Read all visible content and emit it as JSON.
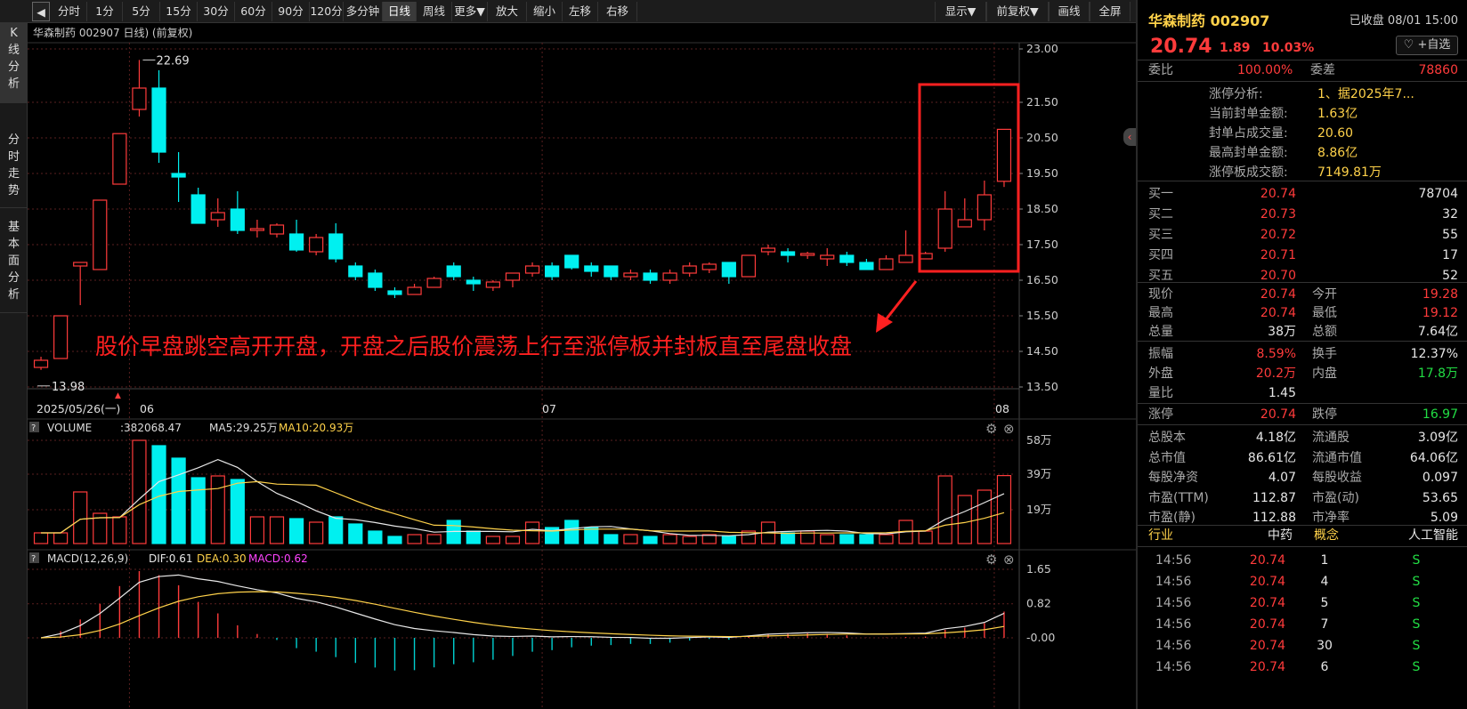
{
  "toolbar": {
    "items": [
      {
        "label": "分时",
        "active": false
      },
      {
        "label": "1分",
        "active": false
      },
      {
        "label": "5分",
        "active": false
      },
      {
        "label": "15分",
        "active": false
      },
      {
        "label": "30分",
        "active": false
      },
      {
        "label": "60分",
        "active": false
      },
      {
        "label": "90分",
        "active": false
      },
      {
        "label": "120分",
        "active": false
      },
      {
        "label": "多分钟",
        "active": false
      },
      {
        "label": "日线",
        "active": true
      },
      {
        "label": "周线",
        "active": false
      },
      {
        "label": "更多▼",
        "active": false
      },
      {
        "label": "放大",
        "active": false
      },
      {
        "label": "缩小",
        "active": false
      },
      {
        "label": "左移",
        "active": false
      },
      {
        "label": "右移",
        "active": false
      }
    ],
    "right_items": [
      "显示▼",
      "前复权▼",
      "画线",
      "全屏"
    ]
  },
  "side_tabs": [
    {
      "label": "K线分析",
      "active": true
    },
    {
      "label": "分时走势",
      "active": false
    },
    {
      "label": "基本面分析",
      "active": false
    }
  ],
  "kchart": {
    "header": "华森制药 002907 日线) (前复权)",
    "high_label": "22.69",
    "low_label": "13.98",
    "y_ticks": [
      "23.00",
      "21.50",
      "20.50",
      "19.50",
      "18.50",
      "17.50",
      "16.50",
      "15.50",
      "14.50",
      "13.50"
    ],
    "x_labels": [
      "2025/05/26(一)",
      "06",
      "07",
      "08"
    ],
    "annotation": "股价早盘跳空高开开盘，开盘之后股价震荡上行至涨停板并封板直至尾盘收盘",
    "colors": {
      "up": "#ff3b3b",
      "down": "#00f0f0",
      "grid": "#5a1f1f"
    }
  },
  "volume": {
    "label": "VOLUME",
    "value": ":382068.47",
    "ma5": "MA5:29.25万",
    "ma10": "MA10:20.93万",
    "y_ticks": [
      "58万",
      "39万",
      "19万"
    ]
  },
  "macd": {
    "label": "MACD(12,26,9)",
    "dif": "DIF:0.61",
    "dea": "DEA:0.30",
    "macd": "MACD:0.62",
    "y_ticks": [
      "1.65",
      "0.82",
      "-0.00"
    ]
  },
  "chart_data": {
    "type": "candlestick",
    "title": "华森制药 002907 日线",
    "candles": [
      {
        "o": 14.05,
        "h": 14.35,
        "l": 13.98,
        "c": 14.25,
        "v": 6
      },
      {
        "o": 14.3,
        "h": 15.5,
        "l": 14.3,
        "c": 15.5,
        "v": 6
      },
      {
        "o": 16.9,
        "h": 17.0,
        "l": 15.8,
        "c": 17.0,
        "v": 29
      },
      {
        "o": 16.8,
        "h": 18.75,
        "l": 16.8,
        "c": 18.75,
        "v": 17
      },
      {
        "o": 19.2,
        "h": 20.62,
        "l": 19.2,
        "c": 20.62,
        "v": 15
      },
      {
        "o": 21.3,
        "h": 22.69,
        "l": 21.1,
        "c": 21.9,
        "v": 58
      },
      {
        "o": 21.9,
        "h": 22.4,
        "l": 19.8,
        "c": 20.1,
        "v": 55
      },
      {
        "o": 19.5,
        "h": 20.1,
        "l": 18.7,
        "c": 19.4,
        "v": 48
      },
      {
        "o": 18.9,
        "h": 19.1,
        "l": 18.1,
        "c": 18.1,
        "v": 37
      },
      {
        "o": 18.2,
        "h": 18.8,
        "l": 18.0,
        "c": 18.4,
        "v": 38
      },
      {
        "o": 18.5,
        "h": 19.0,
        "l": 17.8,
        "c": 17.9,
        "v": 36
      },
      {
        "o": 17.9,
        "h": 18.2,
        "l": 17.7,
        "c": 17.95,
        "v": 15
      },
      {
        "o": 17.8,
        "h": 18.1,
        "l": 17.7,
        "c": 18.05,
        "v": 15
      },
      {
        "o": 17.8,
        "h": 18.2,
        "l": 17.3,
        "c": 17.35,
        "v": 14
      },
      {
        "o": 17.3,
        "h": 17.8,
        "l": 17.2,
        "c": 17.7,
        "v": 12
      },
      {
        "o": 17.8,
        "h": 18.1,
        "l": 17.0,
        "c": 17.1,
        "v": 15
      },
      {
        "o": 16.9,
        "h": 17.0,
        "l": 16.5,
        "c": 16.6,
        "v": 11
      },
      {
        "o": 16.7,
        "h": 16.8,
        "l": 16.2,
        "c": 16.3,
        "v": 7
      },
      {
        "o": 16.2,
        "h": 16.3,
        "l": 16.0,
        "c": 16.1,
        "v": 4
      },
      {
        "o": 16.1,
        "h": 16.4,
        "l": 16.1,
        "c": 16.3,
        "v": 5
      },
      {
        "o": 16.3,
        "h": 16.6,
        "l": 16.3,
        "c": 16.55,
        "v": 5
      },
      {
        "o": 16.9,
        "h": 17.0,
        "l": 16.5,
        "c": 16.6,
        "v": 13
      },
      {
        "o": 16.5,
        "h": 16.6,
        "l": 16.2,
        "c": 16.4,
        "v": 7
      },
      {
        "o": 16.3,
        "h": 16.5,
        "l": 16.2,
        "c": 16.45,
        "v": 4
      },
      {
        "o": 16.5,
        "h": 16.7,
        "l": 16.3,
        "c": 16.7,
        "v": 4
      },
      {
        "o": 16.7,
        "h": 17.0,
        "l": 16.6,
        "c": 16.9,
        "v": 12
      },
      {
        "o": 16.9,
        "h": 17.0,
        "l": 16.5,
        "c": 16.6,
        "v": 9
      },
      {
        "o": 17.2,
        "h": 17.2,
        "l": 16.8,
        "c": 16.85,
        "v": 13
      },
      {
        "o": 16.9,
        "h": 17.0,
        "l": 16.6,
        "c": 16.75,
        "v": 9
      },
      {
        "o": 16.9,
        "h": 16.9,
        "l": 16.5,
        "c": 16.6,
        "v": 5
      },
      {
        "o": 16.6,
        "h": 16.8,
        "l": 16.5,
        "c": 16.7,
        "v": 5
      },
      {
        "o": 16.7,
        "h": 16.8,
        "l": 16.4,
        "c": 16.5,
        "v": 4
      },
      {
        "o": 16.5,
        "h": 16.8,
        "l": 16.4,
        "c": 16.7,
        "v": 5
      },
      {
        "o": 16.7,
        "h": 17.0,
        "l": 16.6,
        "c": 16.9,
        "v": 4
      },
      {
        "o": 16.8,
        "h": 17.0,
        "l": 16.7,
        "c": 16.95,
        "v": 5
      },
      {
        "o": 17.0,
        "h": 17.0,
        "l": 16.4,
        "c": 16.6,
        "v": 4
      },
      {
        "o": 16.6,
        "h": 17.2,
        "l": 16.6,
        "c": 17.2,
        "v": 7
      },
      {
        "o": 17.3,
        "h": 17.5,
        "l": 17.2,
        "c": 17.4,
        "v": 12
      },
      {
        "o": 17.3,
        "h": 17.4,
        "l": 17.0,
        "c": 17.2,
        "v": 6
      },
      {
        "o": 17.2,
        "h": 17.3,
        "l": 17.1,
        "c": 17.25,
        "v": 7
      },
      {
        "o": 17.1,
        "h": 17.4,
        "l": 16.9,
        "c": 17.2,
        "v": 5
      },
      {
        "o": 17.2,
        "h": 17.3,
        "l": 16.9,
        "c": 17.0,
        "v": 5
      },
      {
        "o": 17.0,
        "h": 17.1,
        "l": 16.8,
        "c": 16.8,
        "v": 5
      },
      {
        "o": 16.8,
        "h": 17.2,
        "l": 16.8,
        "c": 17.1,
        "v": 5
      },
      {
        "o": 17.0,
        "h": 17.9,
        "l": 17.0,
        "c": 17.2,
        "v": 13
      },
      {
        "o": 17.1,
        "h": 17.3,
        "l": 17.1,
        "c": 17.25,
        "v": 7
      },
      {
        "o": 17.4,
        "h": 19.0,
        "l": 17.3,
        "c": 18.5,
        "v": 38
      },
      {
        "o": 18.0,
        "h": 18.8,
        "l": 18.0,
        "c": 18.2,
        "v": 27
      },
      {
        "o": 18.2,
        "h": 19.3,
        "l": 17.9,
        "c": 18.9,
        "v": 30
      },
      {
        "o": 19.28,
        "h": 20.74,
        "l": 19.12,
        "c": 20.74,
        "v": 38.2
      }
    ]
  },
  "quote": {
    "name": "华森制药 002907",
    "status": "已收盘 08/01 15:00",
    "price": "20.74",
    "change": "1.89",
    "change_pct": "10.03%",
    "add_fav": "+自选",
    "webi_label": "委比",
    "webi": "100.00%",
    "weicha_label": "委差",
    "weicha": "78860",
    "limit_analysis": [
      {
        "k": "涨停分析:",
        "v": "1、据2025年7..."
      },
      {
        "k": "当前封单金额:",
        "v": "1.63亿"
      },
      {
        "k": "封单占成交量:",
        "v": "20.60"
      },
      {
        "k": "最高封单金额:",
        "v": "8.86亿"
      },
      {
        "k": "涨停板成交额:",
        "v": "7149.81万"
      }
    ],
    "bids": [
      {
        "k": "买一",
        "p": "20.74",
        "q": "78704"
      },
      {
        "k": "买二",
        "p": "20.73",
        "q": "32"
      },
      {
        "k": "买三",
        "p": "20.72",
        "q": "55"
      },
      {
        "k": "买四",
        "p": "20.71",
        "q": "17"
      },
      {
        "k": "买五",
        "p": "20.70",
        "q": "52"
      }
    ],
    "stats": [
      [
        {
          "k": "现价",
          "v": "20.74",
          "c": "red"
        },
        {
          "k": "今开",
          "v": "19.28",
          "c": "red"
        }
      ],
      [
        {
          "k": "最高",
          "v": "20.74",
          "c": "red"
        },
        {
          "k": "最低",
          "v": "19.12",
          "c": "red"
        }
      ],
      [
        {
          "k": "总量",
          "v": "38万",
          "c": "white"
        },
        {
          "k": "总额",
          "v": "7.64亿",
          "c": "white"
        }
      ]
    ],
    "stats2": [
      [
        {
          "k": "振幅",
          "v": "8.59%",
          "c": "red"
        },
        {
          "k": "换手",
          "v": "12.37%",
          "c": "white"
        }
      ],
      [
        {
          "k": "外盘",
          "v": "20.2万",
          "c": "red"
        },
        {
          "k": "内盘",
          "v": "17.8万",
          "c": "green"
        }
      ],
      [
        {
          "k": "量比",
          "v": "1.45",
          "c": "white"
        }
      ]
    ],
    "limits": [
      {
        "k": "涨停",
        "v": "20.74",
        "c": "red"
      },
      {
        "k": "跌停",
        "v": "16.97",
        "c": "green"
      }
    ],
    "fundamentals": [
      [
        {
          "k": "总股本",
          "v": "4.18亿"
        },
        {
          "k": "流通股",
          "v": "3.09亿"
        }
      ],
      [
        {
          "k": "总市值",
          "v": "86.61亿"
        },
        {
          "k": "流通市值",
          "v": "64.06亿"
        }
      ],
      [
        {
          "k": "每股净资",
          "v": "4.07"
        },
        {
          "k": "每股收益",
          "v": "0.097"
        }
      ],
      [
        {
          "k": "市盈(TTM)",
          "v": "112.87"
        },
        {
          "k": "市盈(动)",
          "v": "53.65"
        }
      ],
      [
        {
          "k": "市盈(静)",
          "v": "112.88"
        },
        {
          "k": "市净率",
          "v": "5.09"
        }
      ]
    ],
    "industry_label": "行业",
    "industry": "中药",
    "concept_label": "概念",
    "concept": "人工智能",
    "ticks": [
      {
        "t": "14:56",
        "p": "20.74",
        "q": "1",
        "s": "S"
      },
      {
        "t": "14:56",
        "p": "20.74",
        "q": "4",
        "s": "S"
      },
      {
        "t": "14:56",
        "p": "20.74",
        "q": "5",
        "s": "S"
      },
      {
        "t": "14:56",
        "p": "20.74",
        "q": "7",
        "s": "S"
      },
      {
        "t": "14:56",
        "p": "20.74",
        "q": "30",
        "s": "S"
      },
      {
        "t": "14:56",
        "p": "20.74",
        "q": "6",
        "s": "S"
      }
    ]
  }
}
